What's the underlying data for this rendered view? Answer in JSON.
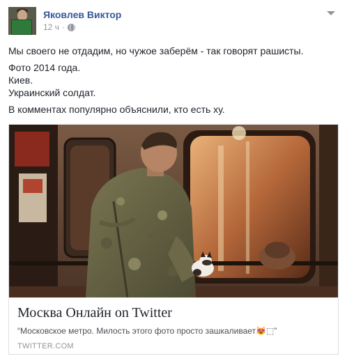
{
  "post": {
    "author": "Яковлев Виктор",
    "time": "12 ч",
    "separator": "·",
    "privacy_icon": "globe-icon",
    "menu_icon": "chevron-down-icon",
    "paragraphs": [
      "Мы своего не отдадим, но чужое заберём - так говорят рашисты.",
      "Фото 2014 года.",
      "Киев.",
      "Украинский солдат.",
      "В комментах популярно объяснили, кто есть ху."
    ]
  },
  "link_card": {
    "title": "Москва Онлайн on Twitter",
    "description": "“Московское метро. Милость этого фото просто зашкаливает😻⬚”",
    "domain": "TWITTER.COM"
  },
  "colors": {
    "author_link": "#365899",
    "meta_gray": "#90949c",
    "text": "#1d2129",
    "card_border": "#dddfe2"
  }
}
